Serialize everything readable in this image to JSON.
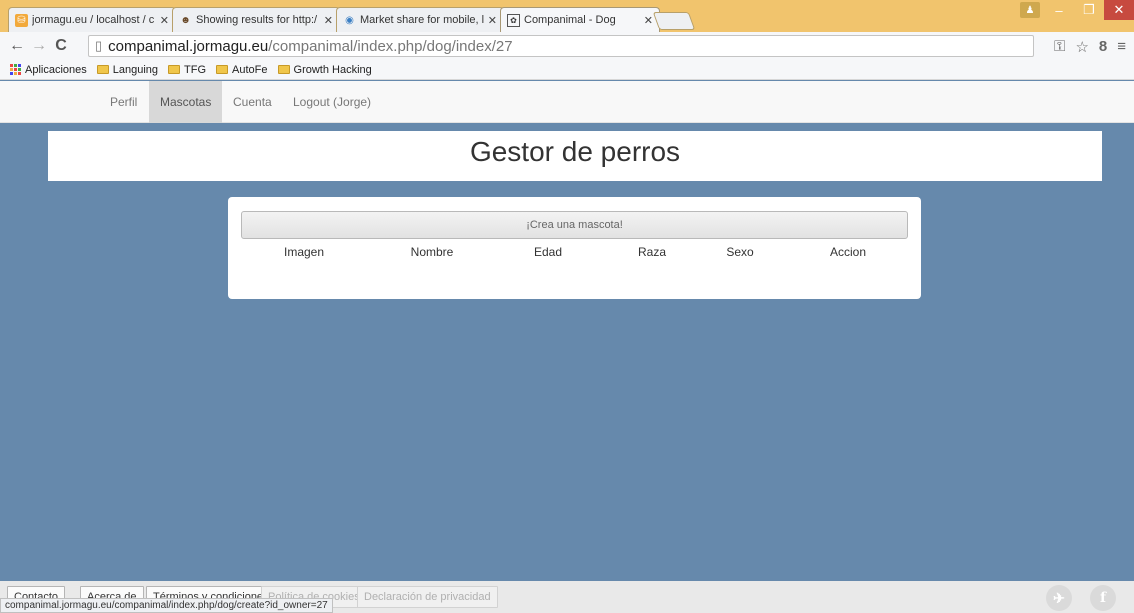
{
  "browser": {
    "tabs": [
      {
        "title": "jormagu.eu / localhost / c",
        "favicon": "phpmyadmin-icon"
      },
      {
        "title": "Showing results for http:/",
        "favicon": "owl-icon"
      },
      {
        "title": "Market share for mobile, l",
        "favicon": "globe-icon"
      },
      {
        "title": "Companimal - Dog",
        "favicon": "paw-icon",
        "active": true
      }
    ],
    "url_host": "companimal.jormagu.eu",
    "url_path": "/companimal/index.php/dog/index/27",
    "bookmarks": [
      "Aplicaciones",
      "Languing",
      "TFG",
      "AutoFe",
      "Growth Hacking"
    ],
    "status_url": "companimal.jormagu.eu/companimal/index.php/dog/create?id_owner=27"
  },
  "nav": {
    "items": [
      "Perfil",
      "Mascotas",
      "Cuenta",
      "Logout (Jorge)"
    ],
    "active": "Mascotas"
  },
  "header": {
    "title": "Gestor de perros"
  },
  "table": {
    "create_label": "¡Crea una mascota!",
    "columns": [
      "Imagen",
      "Nombre",
      "Edad",
      "Raza",
      "Sexo",
      "Accion"
    ]
  },
  "footer": {
    "links": [
      "Contacto",
      "Acerca de",
      "Términos y condiciones",
      "Política de cookies",
      "Declaración de privacidad"
    ],
    "social": [
      "twitter-icon",
      "facebook-icon"
    ]
  },
  "colors": {
    "background": "#6689ac",
    "tabstrip": "#f1c46d",
    "panel": "#ffffff"
  }
}
